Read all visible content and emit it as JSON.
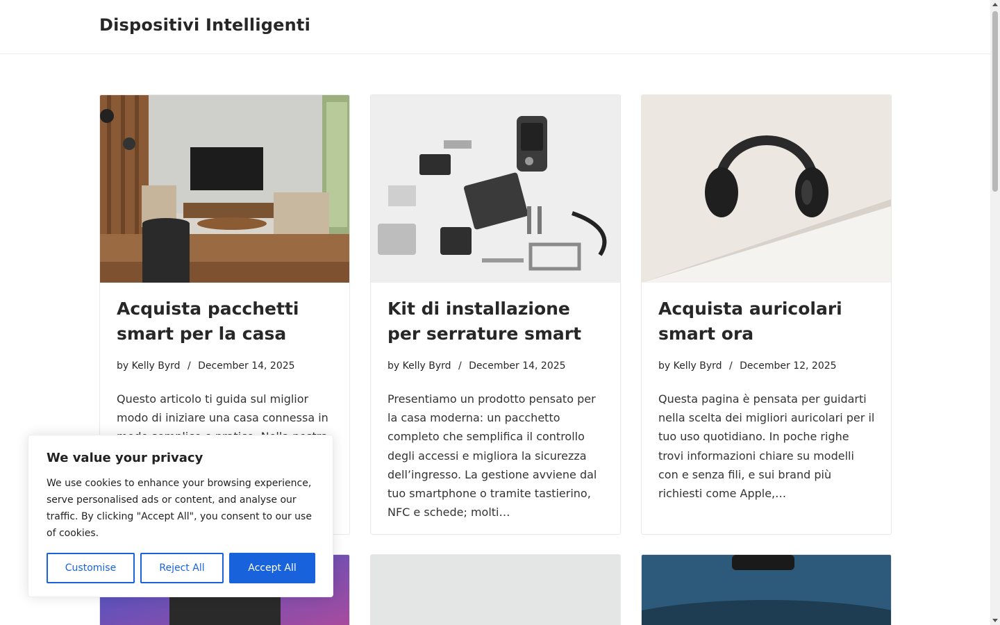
{
  "site": {
    "title": "Dispositivi Intelligenti"
  },
  "posts": [
    {
      "title": "Acquista pacchetti smart per la casa",
      "by": "by",
      "author": "Kelly Byrd",
      "sep": "/",
      "date": "December 14, 2025",
      "excerpt": "Questo articolo ti guida sul miglior modo di iniziare una casa connessa in modo semplice e pratico. Nella nostra",
      "image_icon": "smart-home-living-room-image"
    },
    {
      "title": "Kit di installazione per serrature smart",
      "by": "by",
      "author": "Kelly Byrd",
      "sep": "/",
      "date": "December 14, 2025",
      "excerpt": "Presentiamo un prodotto pensato per la casa moderna: un pacchetto completo che semplifica il controllo degli accessi e migliora la sicurezza dell’ingresso. La gestione avviene dal tuo smartphone o tramite tastierino, NFC e schede; molti…",
      "image_icon": "smart-lock-kit-image"
    },
    {
      "title": "Acquista auricolari smart ora",
      "by": "by",
      "author": "Kelly Byrd",
      "sep": "/",
      "date": "December 12, 2025",
      "excerpt": "Questa pagina è pensata per guidarti nella scelta dei migliori auricolari per il tuo uso quotidiano. In poche righe trovi informazioni chiare su modelli con e senza fili, e sui brand più richiesti come Apple,…",
      "image_icon": "headphones-image"
    }
  ],
  "cookie_banner": {
    "title": "We value your privacy",
    "text": "We use cookies to enhance your browsing experience, serve personalised ads or content, and analyse our traffic. By clicking \"Accept All\", you consent to our use of cookies.",
    "customise": "Customise",
    "reject": "Reject All",
    "accept": "Accept All"
  },
  "colors": {
    "accent": "#1863dc",
    "text": "#272727"
  }
}
